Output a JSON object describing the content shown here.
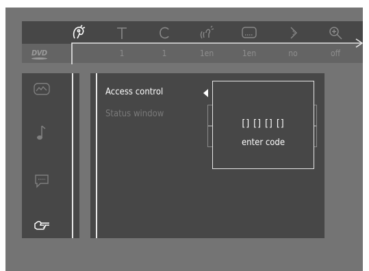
{
  "top_icons": [
    {
      "name": "language-icon",
      "active": true
    },
    {
      "name": "title-icon",
      "active": false
    },
    {
      "name": "chapter-icon",
      "active": false
    },
    {
      "name": "audio-icon",
      "active": false
    },
    {
      "name": "subtitle-icon",
      "active": false
    },
    {
      "name": "angle-icon",
      "active": false
    },
    {
      "name": "zoom-icon",
      "active": false
    }
  ],
  "logo_text": "DVD",
  "values": [
    "1",
    "1",
    "1en",
    "1en",
    "no",
    "off"
  ],
  "left_menu": [
    {
      "icon": "picture-icon",
      "active": false
    },
    {
      "icon": "music-note-icon",
      "active": false
    },
    {
      "icon": "speech-bubble-icon",
      "active": false
    },
    {
      "icon": "hand-pointer-icon",
      "active": true
    }
  ],
  "menu": {
    "items": [
      "Access control",
      "Status window"
    ]
  },
  "popup": {
    "code": "[] [] [] []",
    "label": "enter code"
  },
  "colors": {
    "screen": "#747474",
    "panel": "#474747",
    "active": "#ffffff",
    "inactive": "#7a7a7a",
    "line": "#e8e8e8"
  }
}
